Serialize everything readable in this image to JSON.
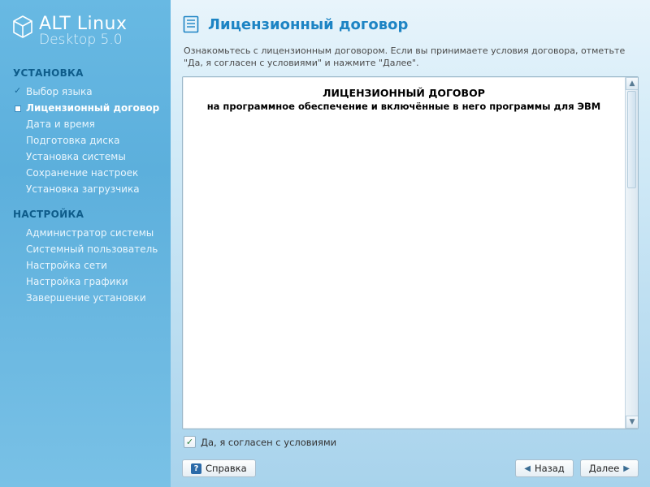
{
  "brand": {
    "line1": "ALT Linux",
    "line2": "Desktop 5.0"
  },
  "sidebar": {
    "section1_title": "УСТАНОВКА",
    "section2_title": "НАСТРОЙКА",
    "install_steps": [
      {
        "label": "Выбор языка",
        "state": "done"
      },
      {
        "label": "Лицензионный договор",
        "state": "current"
      },
      {
        "label": "Дата и время",
        "state": "pending"
      },
      {
        "label": "Подготовка диска",
        "state": "pending"
      },
      {
        "label": "Установка системы",
        "state": "pending"
      },
      {
        "label": "Сохранение настроек",
        "state": "pending"
      },
      {
        "label": "Установка загрузчика",
        "state": "pending"
      }
    ],
    "config_steps": [
      {
        "label": "Администратор системы"
      },
      {
        "label": "Системный пользователь"
      },
      {
        "label": "Настройка сети"
      },
      {
        "label": "Настройка графики"
      },
      {
        "label": "Завершение установки"
      }
    ]
  },
  "page": {
    "title": "Лицензионный договор",
    "instruction": "Ознакомьтесь с лицензионным договором. Если вы принимаете условия договора, отметьте \"Да, я согласен с условиями\" и нажмите \"Далее\"."
  },
  "license": {
    "heading": "ЛИЦЕНЗИОННЫЙ ДОГОВОР",
    "subheading": "на программное обеспечение и включённые в него программы для ЭВМ"
  },
  "agree": {
    "checked": true,
    "label": "Да, я согласен с условиями"
  },
  "buttons": {
    "help": "Справка",
    "back": "Назад",
    "next": "Далее"
  }
}
